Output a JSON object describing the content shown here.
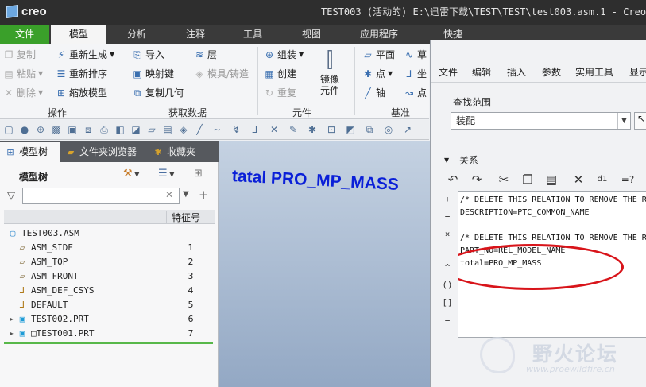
{
  "titlebar": {
    "app_name": "creo",
    "window_title": "TEST003 (活动的) E:\\迅雷下载\\TEST\\TEST\\test003.asm.1 - Creo"
  },
  "ribbon_tabs": [
    {
      "label": "文件",
      "state": "file"
    },
    {
      "label": "模型",
      "state": "active"
    },
    {
      "label": "分析",
      "state": "normal"
    },
    {
      "label": "注释",
      "state": "normal"
    },
    {
      "label": "工具",
      "state": "normal"
    },
    {
      "label": "视图",
      "state": "normal"
    },
    {
      "label": "应用程序",
      "state": "normal"
    },
    {
      "label": "快捷",
      "state": "normal"
    }
  ],
  "ribbon": {
    "operations": {
      "copy": "复制",
      "paste": "粘贴",
      "delete": "删除",
      "regenerate": "重新生成",
      "reorder": "重新排序",
      "shrinkwrap": "缩放模型",
      "group_label": "操作"
    },
    "get_data": {
      "import": "导入",
      "layer": "层",
      "shrink": "映射键",
      "mold": "模具/铸造",
      "copy_geom": "复制几何",
      "group_label": "获取数据"
    },
    "components": {
      "assemble": "组装",
      "create": "创建",
      "repeat": "重复",
      "mirror": "镜像",
      "mirror_line2": "元件",
      "group_label": "元件"
    },
    "datum": {
      "plane": "平面",
      "sketch": "草",
      "point": "点",
      "csys": "坐",
      "axis": "轴",
      "point2": "点",
      "group_label": "基准"
    }
  },
  "left_pane": {
    "tabs": [
      {
        "label": "模型树"
      },
      {
        "label": "文件夹浏览器"
      },
      {
        "label": "收藏夹"
      }
    ],
    "tree_title": "模型树",
    "search": {
      "value": "",
      "placeholder": ""
    },
    "column_feature": "特征号",
    "tree": [
      {
        "name": "TEST003.ASM",
        "number": "",
        "kind": "asm",
        "expandable": false,
        "indent": 0
      },
      {
        "name": "ASM_SIDE",
        "number": "1",
        "kind": "plane",
        "expandable": false,
        "indent": 1
      },
      {
        "name": "ASM_TOP",
        "number": "2",
        "kind": "plane",
        "expandable": false,
        "indent": 1
      },
      {
        "name": "ASM_FRONT",
        "number": "3",
        "kind": "plane",
        "expandable": false,
        "indent": 1
      },
      {
        "name": "ASM_DEF_CSYS",
        "number": "4",
        "kind": "csys",
        "expandable": false,
        "indent": 1
      },
      {
        "name": "DEFAULT",
        "number": "5",
        "kind": "csys",
        "expandable": false,
        "indent": 1
      },
      {
        "name": "TEST002.PRT",
        "number": "6",
        "kind": "prt",
        "expandable": true,
        "indent": 1
      },
      {
        "name": "□TEST001.PRT",
        "number": "7",
        "kind": "prt",
        "expandable": true,
        "indent": 1
      }
    ]
  },
  "graphics": {
    "label": "tatal PRO_MP_MASS"
  },
  "relations_dialog": {
    "menu": [
      "文件",
      "编辑",
      "插入",
      "参数",
      "实用工具",
      "显示"
    ],
    "look_in_label": "查找范围",
    "look_in_value": "装配",
    "section_label": "关系",
    "side_tools": [
      "+",
      "−",
      "×",
      "^",
      "()",
      "[]",
      "="
    ],
    "lines": [
      "/* DELETE THIS RELATION TO REMOVE THE RE",
      "DESCRIPTION=PTC_COMMON_NAME",
      "",
      "/* DELETE THIS RELATION TO REMOVE THE RE",
      "PART_NO=REL_MODEL_NAME",
      "total=PRO_MP_MASS"
    ]
  },
  "watermark": {
    "cn_text": "野火论坛",
    "url": "www.proewildfire.cn"
  },
  "colors": {
    "file_tab": "#3aa02a",
    "highlight_ellipse": "#d8141a",
    "graphics_label": "#0a1fd8"
  }
}
